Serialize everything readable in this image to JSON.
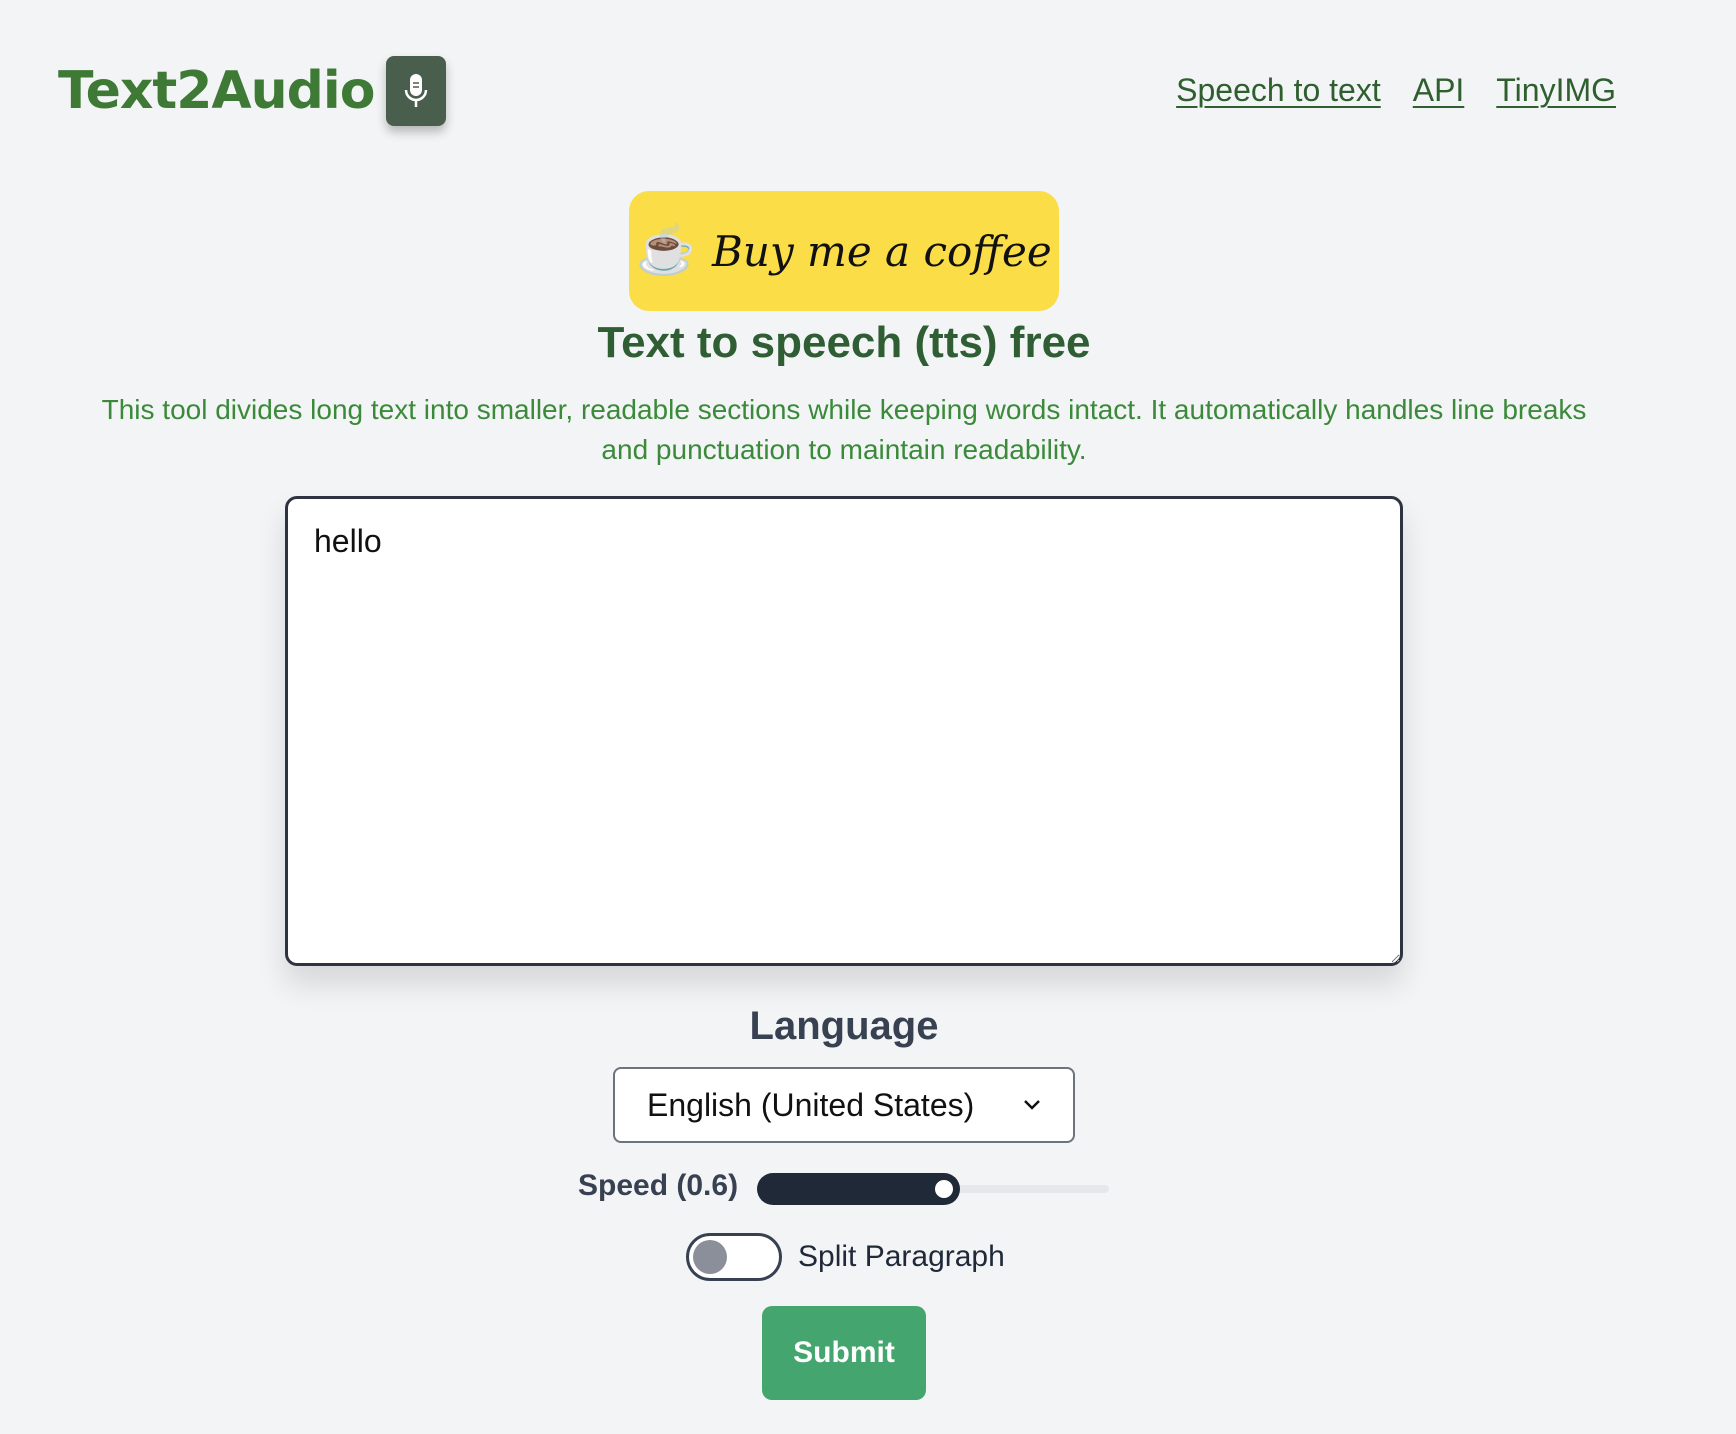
{
  "header": {
    "logo_text": "Text2Audio",
    "logo_icon": "microphone-icon",
    "nav": [
      {
        "label": "Speech to text"
      },
      {
        "label": "API"
      },
      {
        "label": "TinyIMG"
      }
    ]
  },
  "coffee": {
    "icon": "☕",
    "label": "Buy me a coffee"
  },
  "main": {
    "title": "Text to speech (tts) free",
    "description": "This tool divides long text into smaller, readable sections while keeping words intact. It automatically handles line breaks and punctuation to maintain readability.",
    "textarea_value": "hello"
  },
  "language": {
    "label": "Language",
    "selected": "English (United States)"
  },
  "speed": {
    "label": "Speed",
    "value_text": "(0.6)",
    "value": 0.6,
    "min": 0,
    "max": 1
  },
  "split": {
    "label": "Split Paragraph",
    "enabled": false
  },
  "submit": {
    "label": "Submit"
  },
  "colors": {
    "brand_green": "#3e7a35",
    "coffee_yellow": "#fadd47",
    "submit_green": "#45a56e",
    "dark": "#1f2937"
  }
}
